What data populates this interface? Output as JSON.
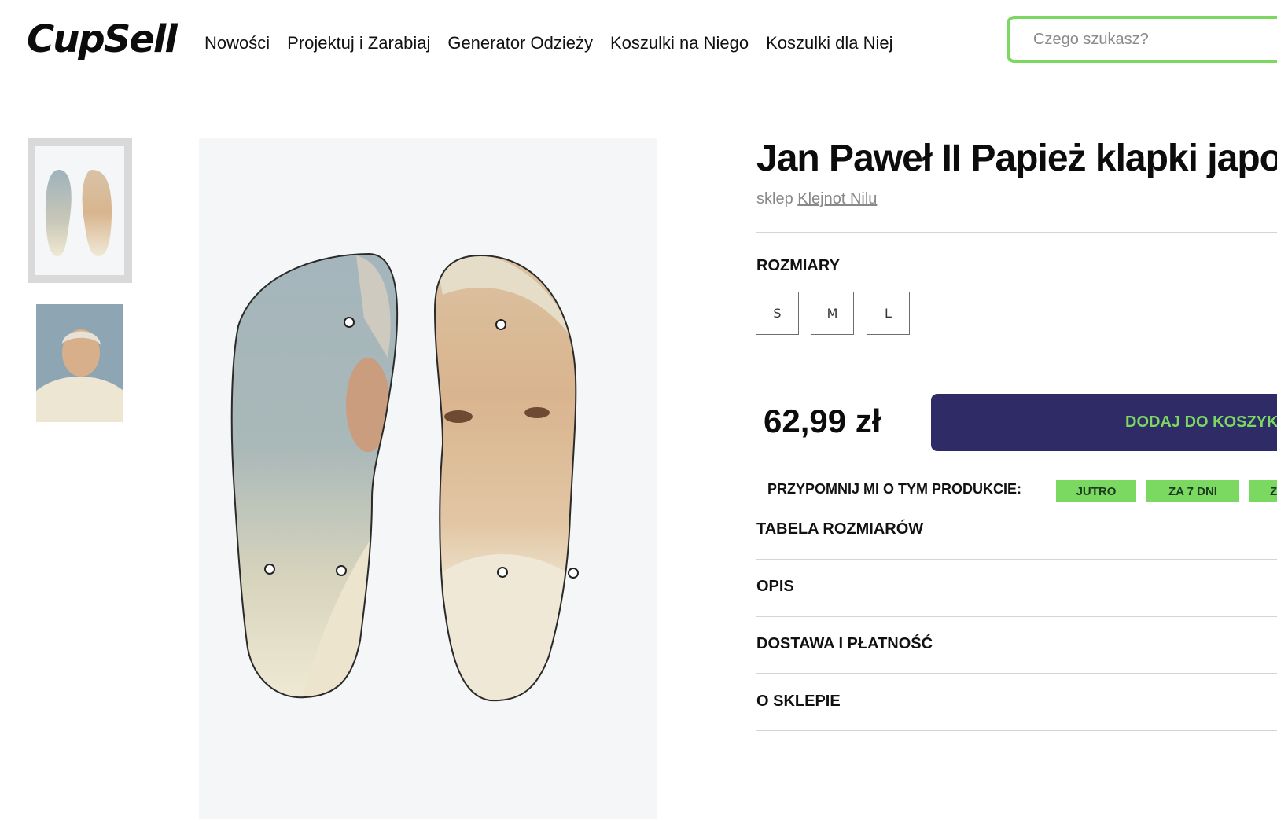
{
  "header": {
    "logo_text": "CupSell",
    "nav": [
      {
        "label": "Nowości"
      },
      {
        "label": "Projektuj i Zarabiaj"
      },
      {
        "label": "Generator Odzieży"
      },
      {
        "label": "Koszulki na Niego"
      },
      {
        "label": "Koszulki dla Niej"
      }
    ],
    "search_placeholder": "Czego szukasz?"
  },
  "gallery": {
    "thumbnails": [
      "flip-flops-thumbnail",
      "portrait-thumbnail"
    ],
    "selected_index": 0
  },
  "product": {
    "title": "Jan Paweł II Papież klapki japon",
    "shop_prefix": "sklep",
    "shop_name": "Klejnot Nilu",
    "sizes_label": "ROZMIARY",
    "sizes": [
      "S",
      "M",
      "L"
    ],
    "price": "62,99 zł",
    "add_to_cart": "DODAJ DO KOSZYK",
    "remind_label": "PRZYPOMNIJ MI O TYM PRODUKCIE:",
    "remind_options": [
      "JUTRO",
      "ZA 7 DNI",
      "Z"
    ],
    "accordion": [
      {
        "label": "TABELA ROZMIARÓW"
      },
      {
        "label": "OPIS"
      },
      {
        "label": "DOSTAWA I PŁATNOŚĆ"
      },
      {
        "label": "O SKLEPIE"
      }
    ]
  },
  "colors": {
    "accent_green": "#7bd962",
    "button_navy": "#2e2b66"
  }
}
